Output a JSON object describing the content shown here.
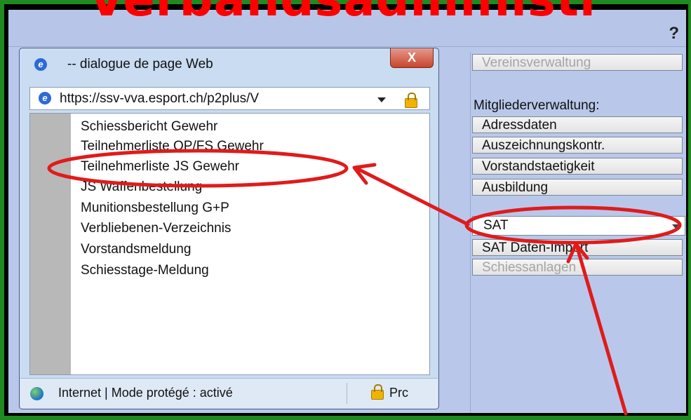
{
  "banner": {
    "text": "Verbandsadministr"
  },
  "app": {
    "help_label": "?"
  },
  "right_panel": {
    "top_button": "Vereinsverwaltung",
    "section_label": "Mitgliederverwaltung:",
    "buttons": [
      "Adressdaten",
      "Auszeichnungskontr.",
      "Vorstandstaetigkeit",
      "Ausbildung"
    ],
    "dropdown": {
      "selected": "SAT"
    },
    "sat_buttons": [
      "SAT Daten-Import",
      "Schiessanlagen"
    ]
  },
  "dialog": {
    "title": "-- dialogue de page Web",
    "close_label": "X",
    "address": "https://ssv-vva.esport.ch/p2plus/V",
    "menu": [
      "Schiessbericht Gewehr",
      "Teilnehmerliste OP/FS Gewehr",
      "Teilnehmerliste JS Gewehr",
      "JS Waffenbestellung",
      "Munitionsbestellung G+P",
      "Verbliebenen-Verzeichnis",
      "Vorstandsmeldung",
      "Schiesstage-Meldung"
    ],
    "status": "Internet | Mode protégé : activé",
    "status_right": "Prc"
  },
  "colors": {
    "annotation": "#e01b1b",
    "banner": "#ff0000",
    "outer_frame": "#1f8a1f",
    "panel": "#b9c8ea"
  },
  "icons": [
    "ie-icon",
    "lock-icon",
    "globe-icon",
    "chevron-down-icon",
    "close-icon"
  ]
}
